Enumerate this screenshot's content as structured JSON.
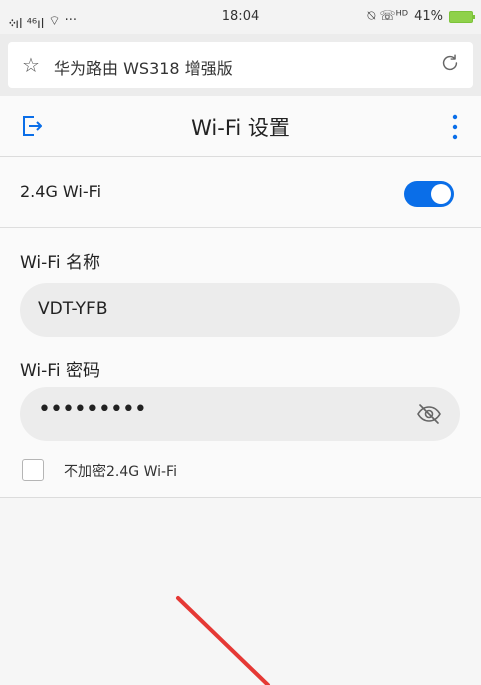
{
  "status_bar": {
    "network": "᠅ıl ⁴⁶ıl",
    "wifi": "⌔",
    "more": "···",
    "time": "18:04",
    "tags": "⍉ ☏ᴴᴰ",
    "battery_percent": "41%"
  },
  "address_bar": {
    "title": "华为路由 WS318 增强版"
  },
  "header": {
    "title": "Wi-Fi 设置"
  },
  "band": {
    "label": "2.4G Wi-Fi",
    "enabled": true
  },
  "wifi_name": {
    "label": "Wi-Fi 名称",
    "value": "VDT-YFB"
  },
  "wifi_password": {
    "label": "Wi-Fi 密码",
    "masked_value": "•••••••••"
  },
  "no_encrypt": {
    "label": "不加密2.4G Wi-Fi",
    "checked": false
  },
  "colors": {
    "accent": "#0a6ee8",
    "annotation_arrow": "#e53935"
  }
}
